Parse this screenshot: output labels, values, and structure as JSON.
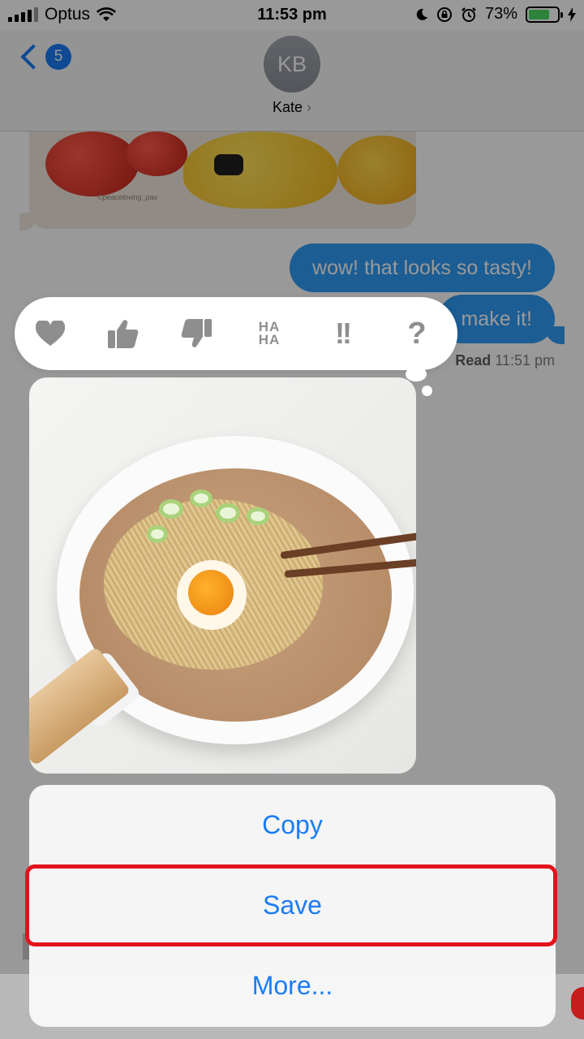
{
  "status_bar": {
    "carrier": "Optus",
    "time": "11:53 pm",
    "battery_percent": "73%",
    "battery_level": 0.73,
    "icons": [
      "signal-icon",
      "wifi-icon",
      "moon-icon",
      "orientation-lock-icon",
      "alarm-icon",
      "battery-icon",
      "charging-icon"
    ]
  },
  "header": {
    "back_badge": "5",
    "avatar_initials": "KB",
    "contact_name": "Kate",
    "contact_arrow": "›"
  },
  "messages": {
    "photo_credit": "©peaceloving_pax",
    "sent": [
      {
        "text": "wow! that looks so tasty!"
      },
      {
        "text": "make it!"
      }
    ],
    "read_label": "Read",
    "read_time": "11:51 pm"
  },
  "tapback": {
    "reactions": [
      "heart-icon",
      "thumbs-up-icon",
      "thumbs-down-icon",
      "haha-icon",
      "exclamation-icon",
      "question-icon"
    ],
    "haha_top": "HA",
    "haha_bottom": "HA",
    "exclaim": "!!",
    "question": "?"
  },
  "action_menu": {
    "options": [
      {
        "label": "Copy"
      },
      {
        "label": "Save"
      },
      {
        "label": "More..."
      }
    ]
  },
  "colors": {
    "accent": "#1a7cf5",
    "bubble_blue": "#2f9bf6",
    "highlight_red": "#e3131c"
  }
}
